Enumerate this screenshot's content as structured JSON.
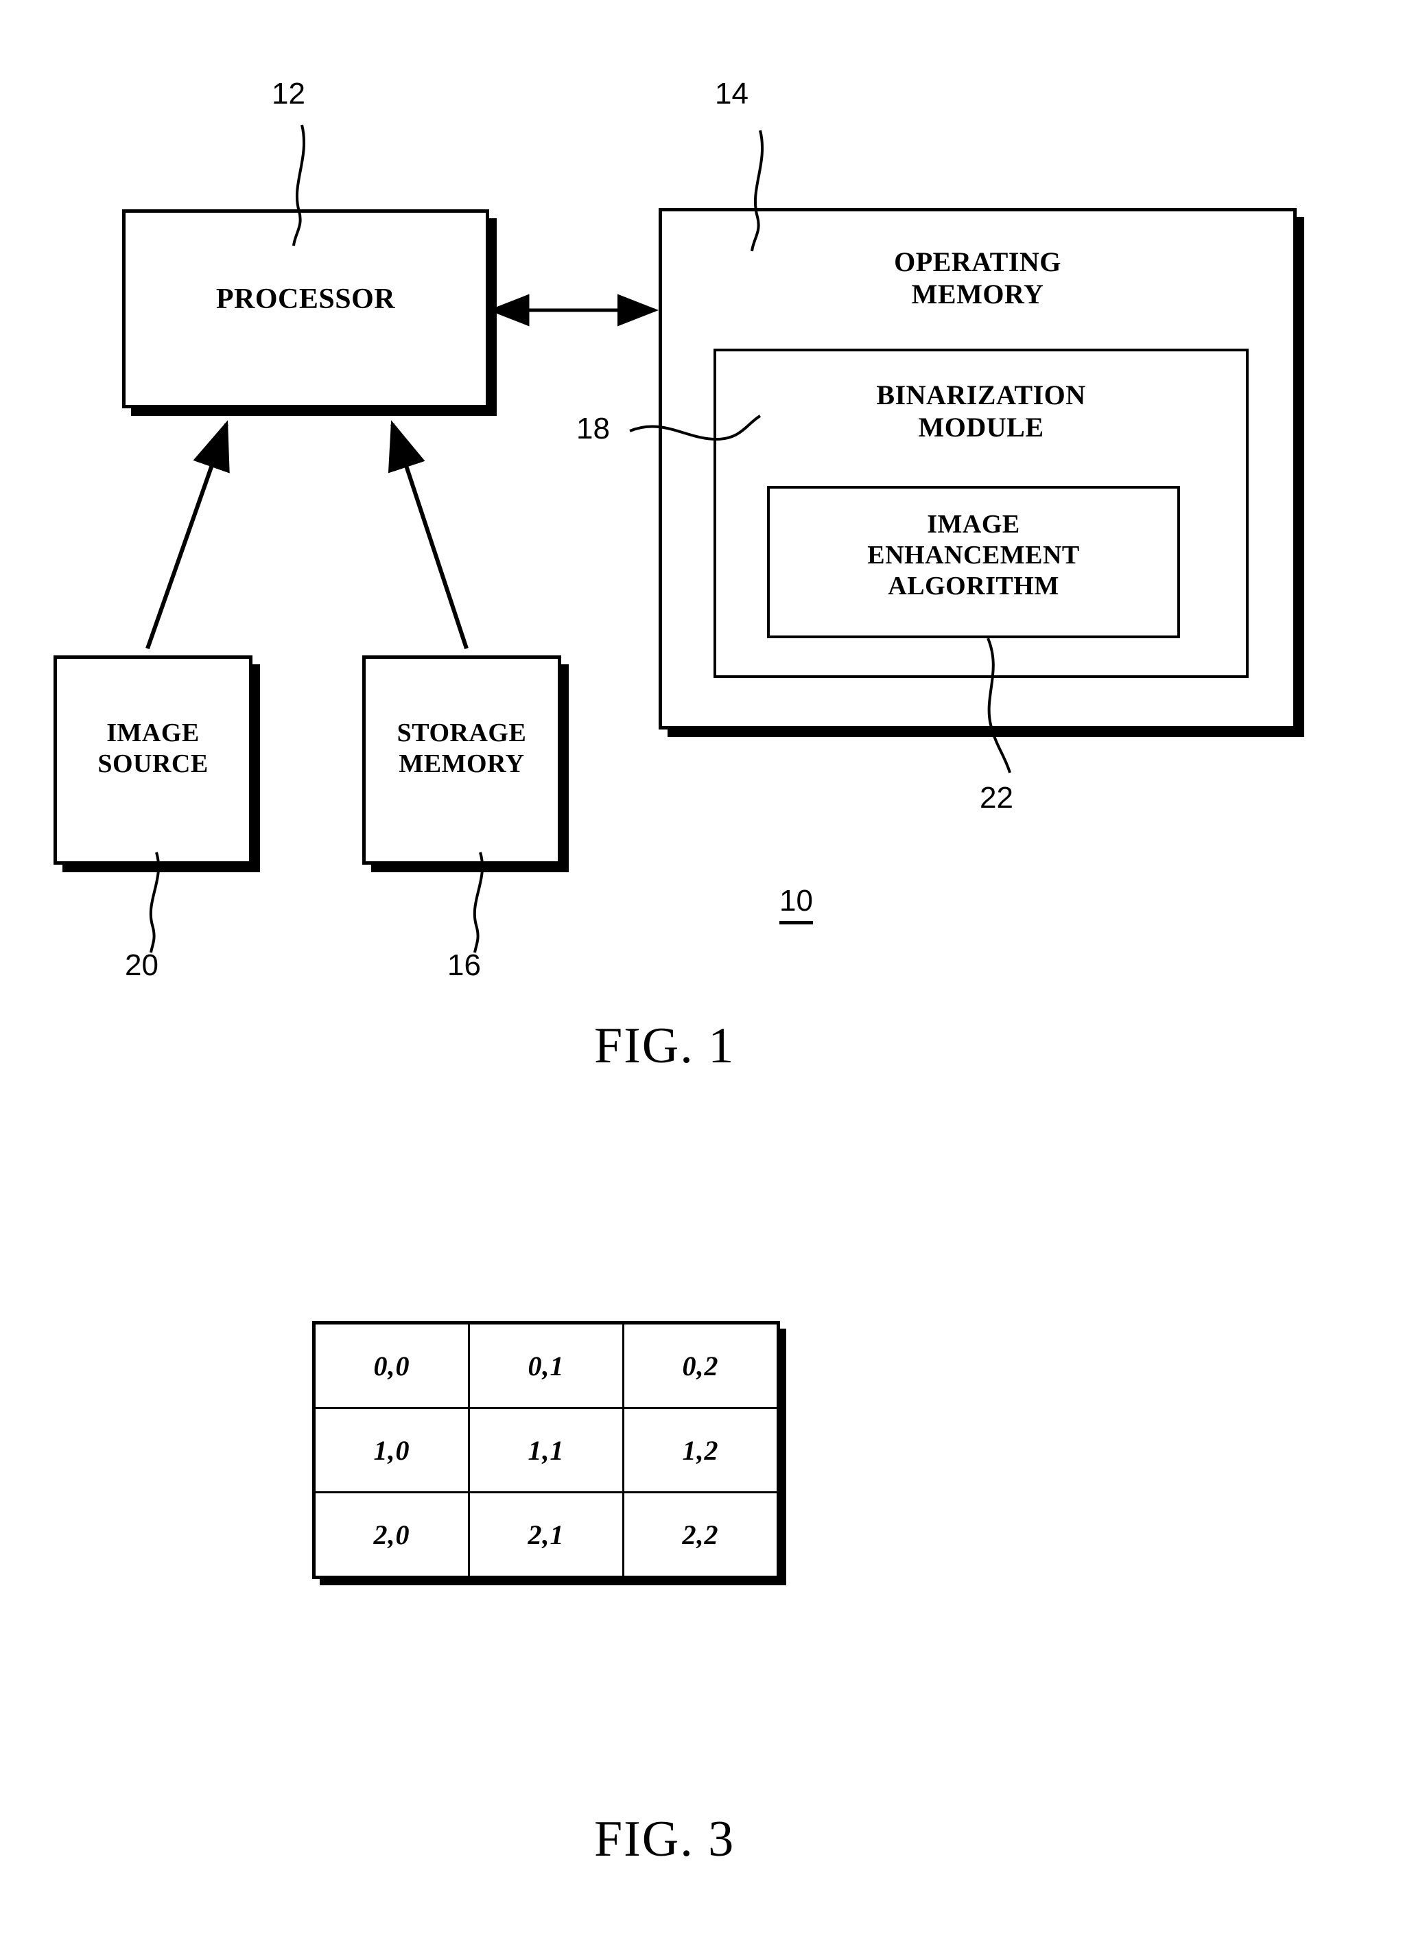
{
  "figure1": {
    "caption": "FIG. 1",
    "system_ref": "10",
    "blocks": {
      "processor": {
        "label": "PROCESSOR",
        "ref": "12"
      },
      "operating_memory": {
        "label": "OPERATING\nMEMORY",
        "ref": "14"
      },
      "binarization_module": {
        "label": "BINARIZATION\nMODULE",
        "ref": "18"
      },
      "image_enhancement_algorithm": {
        "label": "IMAGE\nENHANCEMENT\nALGORITHM",
        "ref": "22"
      },
      "image_source": {
        "label": "IMAGE\nSOURCE",
        "ref": "20"
      },
      "storage_memory": {
        "label": "STORAGE\nMEMORY",
        "ref": "16"
      }
    },
    "connectors": [
      {
        "name": "processor-memory-bus",
        "from": "processor",
        "to": "operating_memory",
        "style": "double-arrow"
      },
      {
        "name": "image-source-to-processor",
        "from": "image_source",
        "to": "processor",
        "style": "single-arrow"
      },
      {
        "name": "storage-memory-to-processor",
        "from": "storage_memory",
        "to": "processor",
        "style": "single-arrow"
      }
    ]
  },
  "figure3": {
    "caption": "FIG. 3",
    "chart_data": {
      "type": "table",
      "title": "FIG. 3",
      "rows": 3,
      "columns": 3,
      "cells": [
        [
          "0,0",
          "0,1",
          "0,2"
        ],
        [
          "1,0",
          "1,1",
          "1,2"
        ],
        [
          "2,0",
          "2,1",
          "2,2"
        ]
      ]
    }
  },
  "colors": {
    "ink": "#000000",
    "paper": "#ffffff"
  }
}
